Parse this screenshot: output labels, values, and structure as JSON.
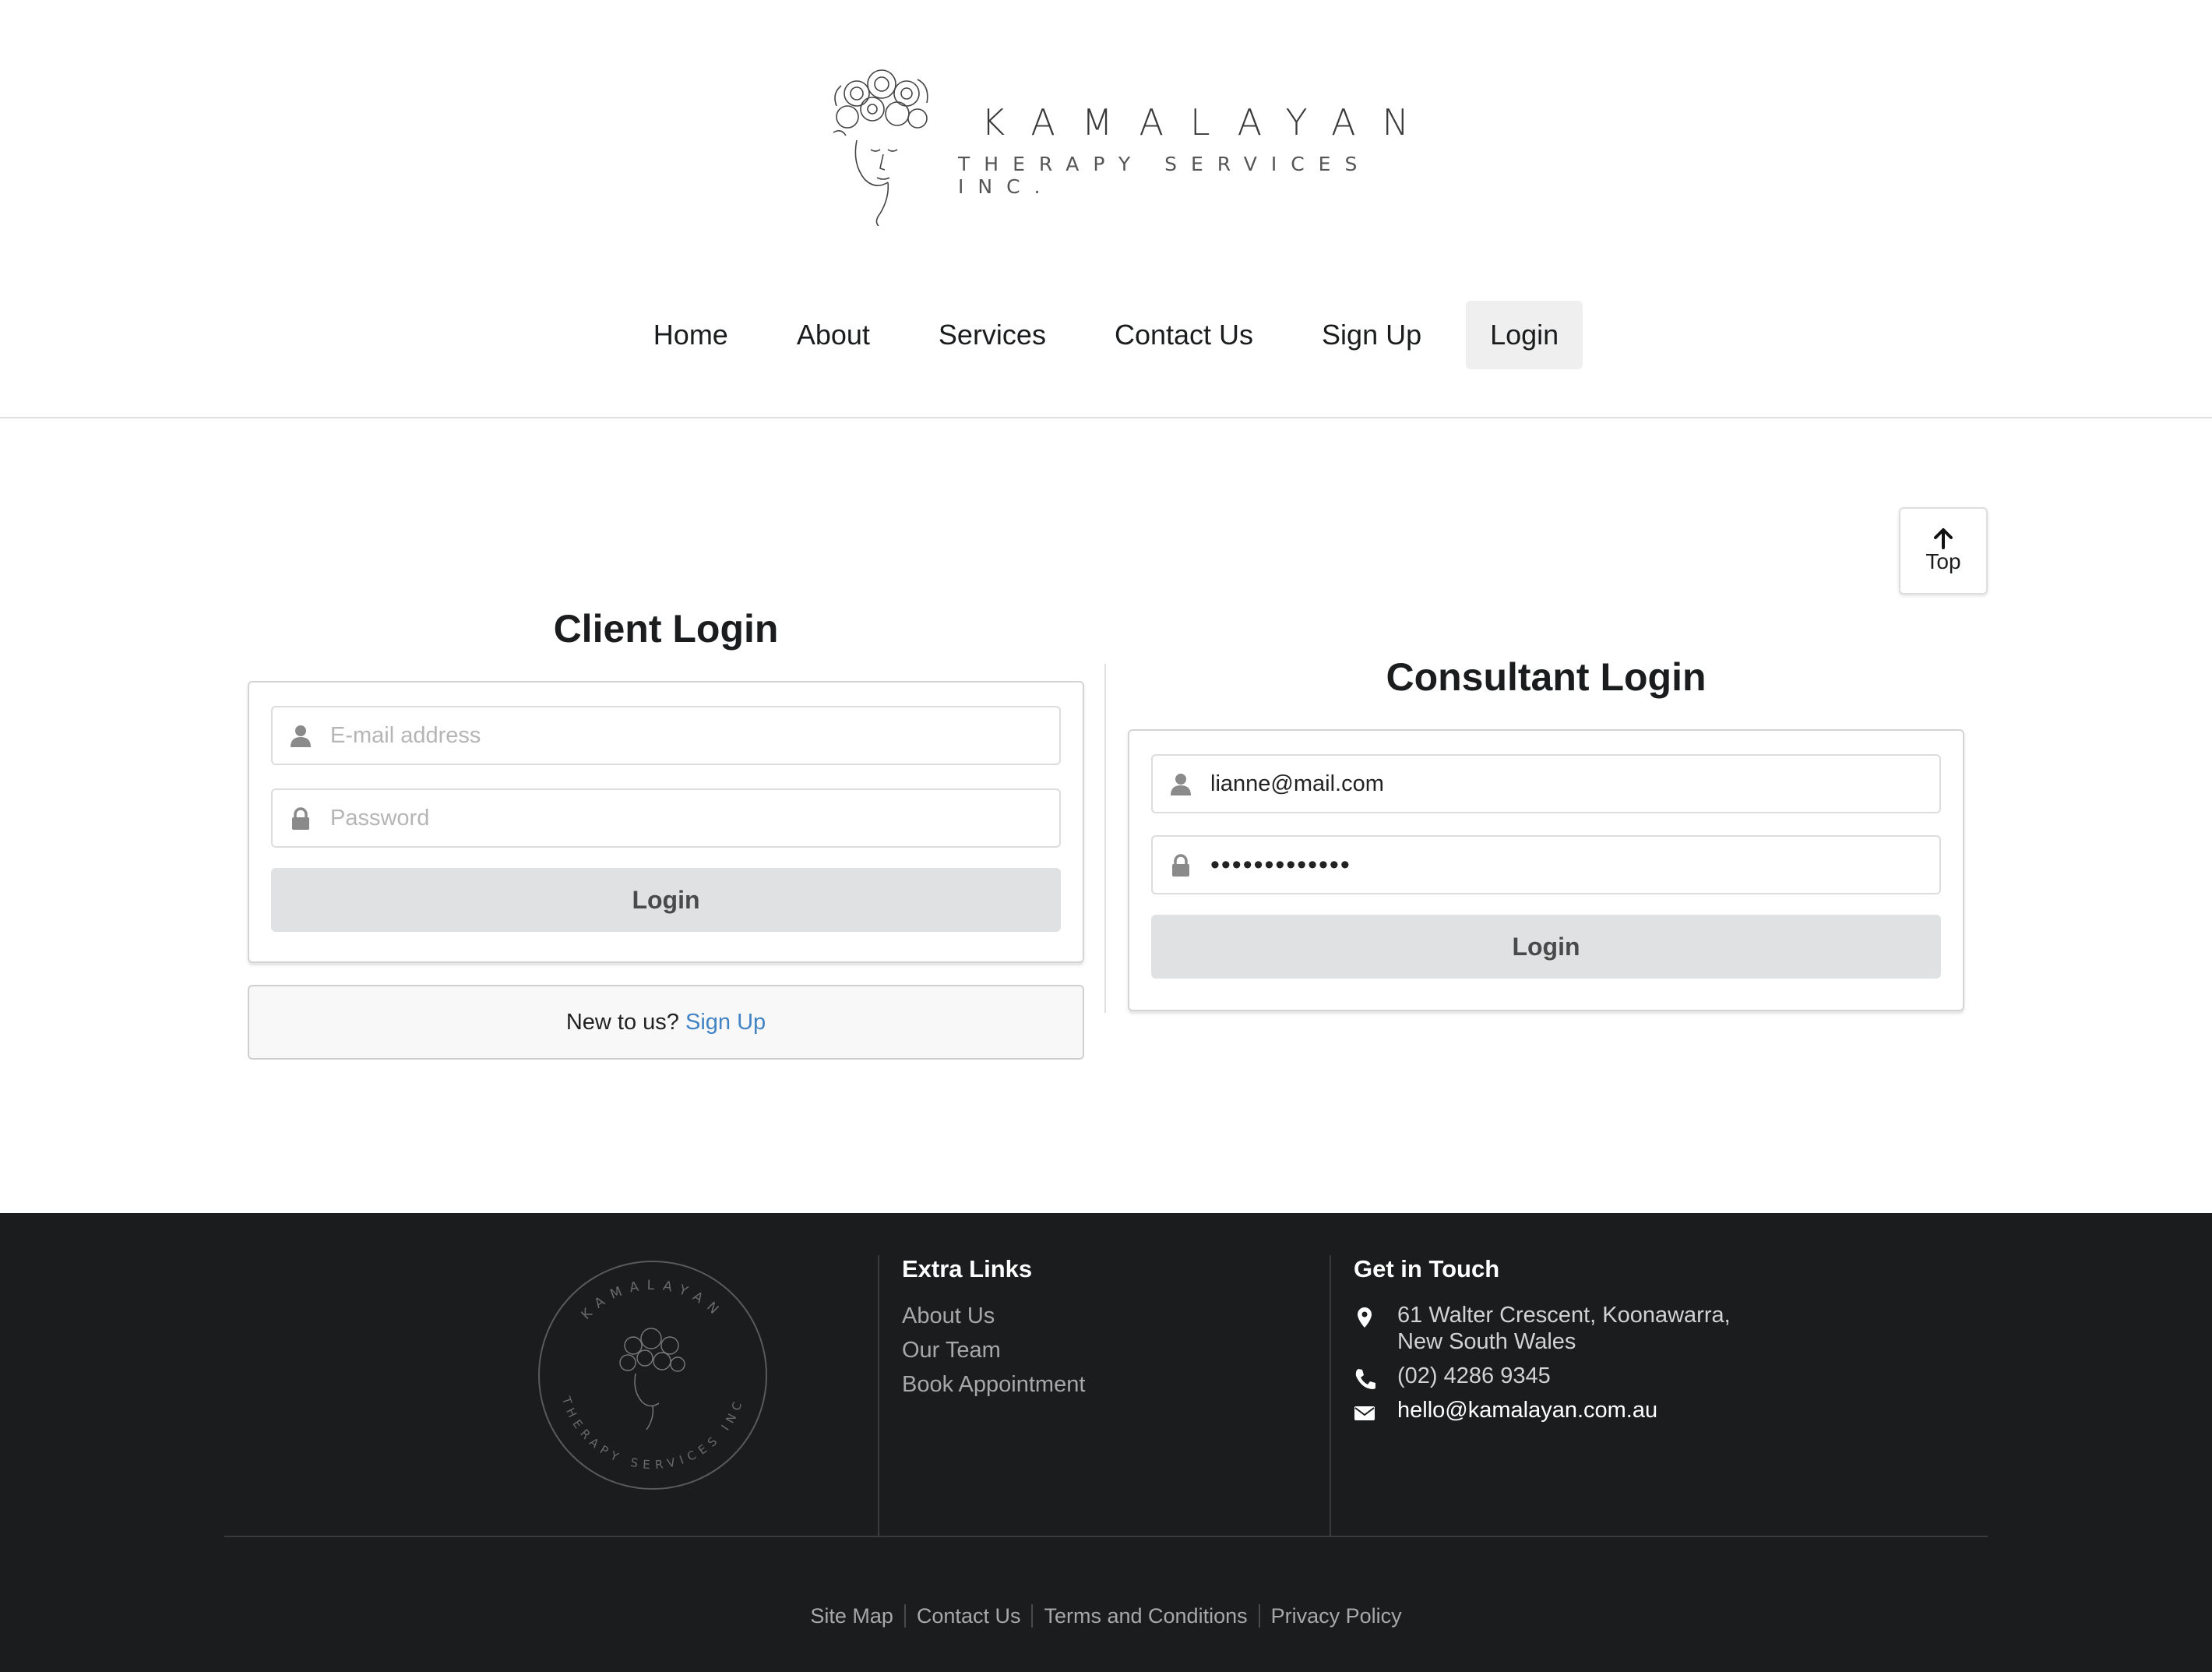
{
  "brand": {
    "name": "KAMALAYAN",
    "tagline": "THERAPY SERVICES INC."
  },
  "nav": {
    "items": [
      "Home",
      "About",
      "Services",
      "Contact Us",
      "Sign Up",
      "Login"
    ],
    "active": "Login"
  },
  "top_button": {
    "label": "Top",
    "icon": "arrow-up-icon"
  },
  "client_login": {
    "title": "Client Login",
    "email_placeholder": "E-mail address",
    "email_value": "",
    "password_placeholder": "Password",
    "password_value": "",
    "button": "Login",
    "signup_prompt": "New to us?",
    "signup_link": "Sign Up"
  },
  "consultant_login": {
    "title": "Consultant Login",
    "email_value": "lianne@mail.com",
    "password_value": "•••••••••••••",
    "button": "Login"
  },
  "footer": {
    "seal": {
      "top_text": "KAMALAYAN",
      "bottom_text": "THERAPY SERVICES INC"
    },
    "extra_links": {
      "title": "Extra Links",
      "items": [
        "About Us",
        "Our Team",
        "Book Appointment"
      ]
    },
    "get_in_touch": {
      "title": "Get in Touch",
      "address_line1": "61 Walter Crescent, Koonawarra,",
      "address_line2": "New South Wales",
      "phone": "(02) 4286 9345",
      "email": "hello@kamalayan.com.au"
    },
    "bottom_links": [
      "Site Map",
      "Contact Us",
      "Terms and Conditions",
      "Privacy Policy"
    ]
  },
  "colors": {
    "footer_bg": "#1b1c1d",
    "link_blue": "#4183c4",
    "button_grey": "#e0e1e2"
  }
}
